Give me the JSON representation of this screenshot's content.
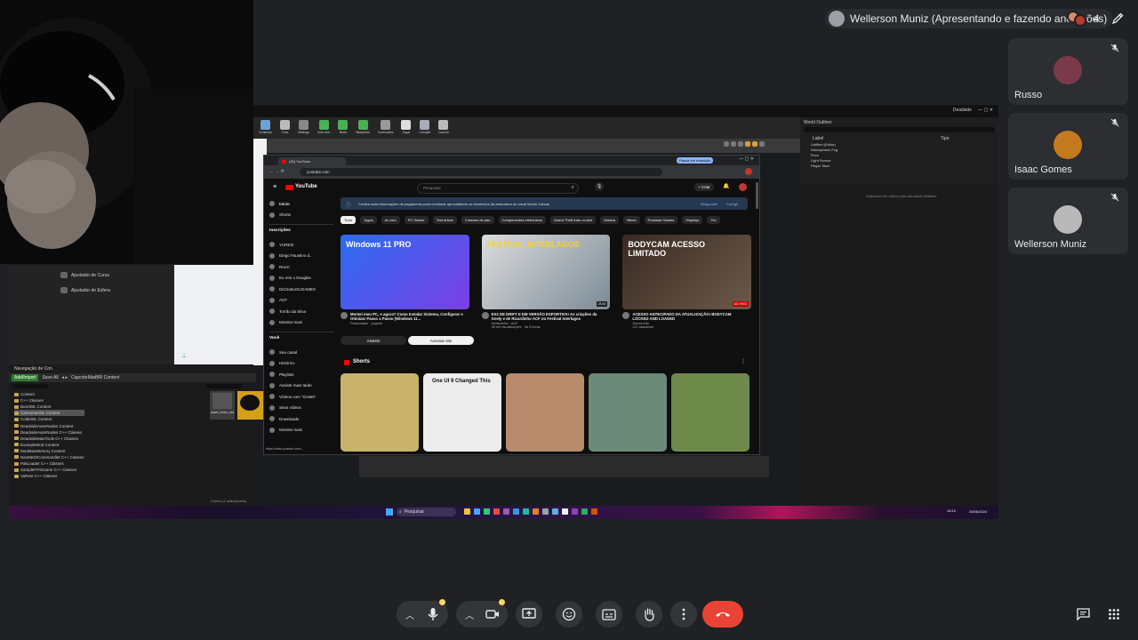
{
  "meeting": {
    "presenter_label": "Wellerson Muniz (Apresentando e fazendo anotações)",
    "participant_count": "4"
  },
  "participants": [
    {
      "name": "Russo",
      "avatar_color": "#7a3a4a",
      "mic_icon": "mic-off-icon"
    },
    {
      "name": "Isaac Gomes",
      "avatar_color": "#c47a1e",
      "mic_icon": "mic-off-icon"
    },
    {
      "name": "Wellerson Muniz",
      "avatar_color": "#b9b9b9",
      "mic_icon": "mic-off-icon"
    }
  ],
  "shared_screen": {
    "ue": {
      "toolbar_labels": [
        "Conteúdo",
        "Criar",
        "Settings",
        "Criar ator",
        "Build",
        "Blueprints",
        "Cinematics",
        "Jogar",
        "Compile",
        "Launch"
      ],
      "content_browser": {
        "tab": "Navegação de Con.",
        "add_import": "Add/Import",
        "save_all": "Save All",
        "path": "CapcoteMadBR Content",
        "folders": [
          "Content",
          "C++ Classes",
          "BurntWL Content",
          "CarHunterWL Content",
          "ColdeWL Content",
          "DeadsideAvanNodes Content",
          "DeadsideAvanNodes C++ Classes",
          "DeadsideMaxTools C++ Classes",
          "ExampleMod Content",
          "ModMaxMemory Content",
          "NavMeshCommandlet C++ Classes",
          "PakLoader C++ Classes",
          "SampleFPSGame C++ Classes",
          "VaRest C++ Classes"
        ],
        "status": "2 itens (1 selecionado)",
        "asset_label": "asset_folder_asset_gun"
      },
      "outliner": {
        "title": "World Outliner",
        "col_label": "Label",
        "col_type": "Tipo",
        "rows": [
          "Untitled (Editor)",
          "Atmospheric Fog",
          "Floor",
          "Light Source",
          "Player Start"
        ],
        "details_hint": "Selecione um objeto para visualizar detalhes"
      },
      "top_right": {
        "mode": "Deadside"
      },
      "extra_items": [
        "Ajustador de Curva",
        "Ajustador de Esfera"
      ]
    },
    "windows_taskbar": {
      "search_placeholder": "Pesquisar",
      "lang": "POR\nPTB2",
      "time": "18:10",
      "date": "26/06/2024"
    },
    "browser": {
      "tab_title": "(25) YouTube",
      "url": "youtube.com",
      "pause_label": "Pausa em transição",
      "youtube": {
        "logo_text": "YouTube",
        "search_placeholder": "Pesquisar",
        "create_label": "+ Criar",
        "sidebar": {
          "main": [
            "Início",
            "Shorts"
          ],
          "subs_title": "Inscrições",
          "subs": [
            "YUREZI",
            "Diego Faustino d..",
            "Renzi",
            "Eu reio o Douglas",
            "DiGmatorSoGAMES",
            "ACF",
            "Torrão da Silva",
            "Mostrar mais"
          ],
          "you_title": "Você",
          "you": [
            "Seu canal",
            "Histórico",
            "Playlists",
            "Assistir mais tarde",
            "Vídeos com \"Gostei\"",
            "Seus vídeos",
            "Downloads",
            "Mostrar mais"
          ]
        },
        "banner": {
          "text": "Confira suas informações de pagamento para continuar aproveitando os benefícios da assinatura do canal Murilo Cabras",
          "action1": "Responder",
          "action2": "Corrigir"
        },
        "chips": [
          "Tudo",
          "Jogos",
          "Ao vivo",
          "PC Gamer",
          "Test drives",
          "Coreano de pau",
          "Componentes eletrônicos",
          "Grand Theft Auto on-line",
          "Música",
          "Mixes",
          "Rockstar Games",
          "Displays",
          "Tec"
        ],
        "videos": [
          {
            "thumb_text": "Windows 11 PRO",
            "title": "Montei meu PC, e agora? Como Instalar Sistema, Configurar e Otimizar Passo a Passo (Windows 11...",
            "channel": "Patrocinado · pcgmdl",
            "meta": "",
            "duration": ""
          },
          {
            "thumb_text": "FESTIVAL INTERLAGOS",
            "title": "EX2 DE DRIFT E EM VERSÃO ESPORTIVA! As criações da Geely e de Ricardinho ACF no Festival Interlagos",
            "channel": "Acelerados · ACF",
            "meta": "40 mil visualizações · há 3 horas",
            "duration": "23:43"
          },
          {
            "thumb_text": "BODYCAM ACESSO LIMITADO",
            "title": "ACESSO ANTECIPADO DA ATUALIZAÇÃO! BODYCAM LOCKED AND LOADED",
            "channel": "Senna Alfa",
            "meta": "112 assistindo",
            "duration": "AO VIVO"
          }
        ],
        "ad_buttons": {
          "watch": "Assistir",
          "visit": "Acessar site"
        },
        "shorts_title": "Shorts",
        "shorts": [
          {
            "color": "#c9b36a",
            "label": ""
          },
          {
            "color": "#ececec",
            "label": "One UI 9 Changed This"
          },
          {
            "color": "#b78a6c",
            "label": ""
          },
          {
            "color": "#6b8a7a",
            "label": ""
          },
          {
            "color": "#6d8a4a",
            "label": ""
          }
        ],
        "status_url": "https://www.youtube.com/..."
      }
    }
  },
  "controls": {
    "mic_icon": "mic-icon",
    "cam_icon": "camera-icon",
    "present_icon": "present-screen-icon",
    "emoji_icon": "emoji-icon",
    "captions_icon": "captions-icon",
    "hand_icon": "raise-hand-icon",
    "more_icon": "more-options-icon",
    "end_icon": "end-call-icon",
    "chat_icon": "chat-icon",
    "activities_icon": "activities-icon"
  },
  "colors": {
    "end_call": "#ea4335",
    "badge": "#fdd663",
    "yt_red": "#ff0000"
  }
}
